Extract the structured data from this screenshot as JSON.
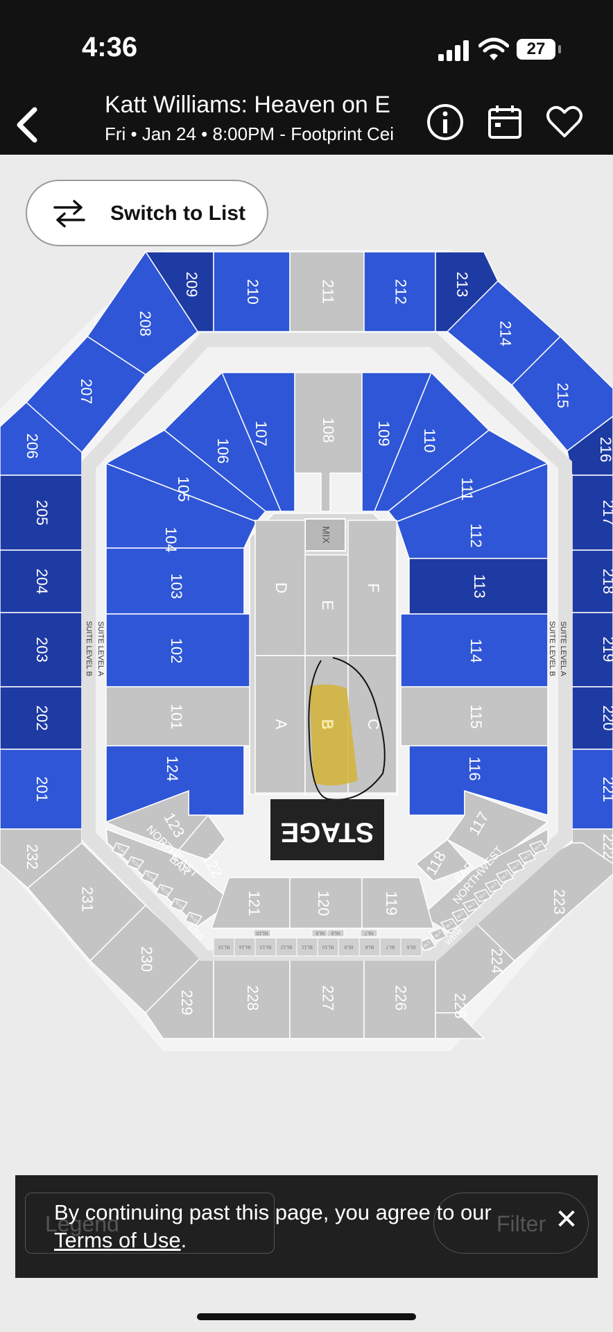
{
  "status": {
    "time": "4:36",
    "battery": "27"
  },
  "header": {
    "title": "Katt Williams: Heaven on E",
    "subtitle": "Fri • Jan 24 • 8:00PM - Footprint Cei",
    "icons": [
      "back-arrow-icon",
      "info-icon",
      "calendar-icon",
      "heart-icon"
    ]
  },
  "switch_button": {
    "label": "Switch to List",
    "icon": "swap-arrows-icon"
  },
  "seatmap": {
    "stage_label": "STAGE",
    "mix_label": "MIX",
    "northeast_bar": [
      "NORTHEAST",
      "BAR"
    ],
    "northwest_bar": [
      "NORTHWEST",
      "BAR"
    ],
    "suite_a": "SUITE LEVEL A",
    "suite_b": "SUITE LEVEL B",
    "ebw": "EBW",
    "wbw": "WBW",
    "floor": [
      "A",
      "B",
      "C",
      "D",
      "E",
      "F"
    ],
    "upper_top": [
      "209",
      "210",
      "211",
      "212",
      "213"
    ],
    "upper_left": [
      "208",
      "207",
      "206",
      "205",
      "204",
      "203",
      "202",
      "201",
      "232",
      "231",
      "230",
      "229"
    ],
    "upper_right": [
      "214",
      "215",
      "216",
      "217",
      "218",
      "219",
      "220",
      "221",
      "222",
      "223",
      "224",
      "225"
    ],
    "upper_bottom": [
      "228",
      "227",
      "226"
    ],
    "lower_top": [
      "107",
      "108",
      "109"
    ],
    "lower_left": [
      "106",
      "105",
      "104",
      "103",
      "102",
      "101",
      "124",
      "123",
      "122"
    ],
    "lower_right": [
      "110",
      "111",
      "112",
      "113",
      "114",
      "115",
      "116",
      "117",
      "118"
    ],
    "lower_bottom": [
      "121",
      "120",
      "119"
    ],
    "boxes_bottom": [
      "BL15",
      "BL14",
      "BL13",
      "BL12",
      "BL11",
      "BL10",
      "BL9",
      "BL8",
      "BL7",
      "BL6"
    ],
    "boxes_nl_top": [
      "NL10",
      "NL9",
      "NL8",
      "NL7"
    ],
    "boxes_ne": [
      "NL16",
      "NL15",
      "NL14",
      "NL13",
      "NL12",
      "NL11"
    ],
    "boxes_nw": [
      "NL6",
      "NL5",
      "NL4",
      "NL3",
      "NL2",
      "NL1",
      "BL1",
      "BL2",
      "BL3",
      "BL4",
      "BL5"
    ]
  },
  "bottom": {
    "legend": "Legend",
    "filter": "Filter"
  },
  "cookie": {
    "text_before": "By continuing past this page, you agree to our ",
    "link": "Terms of Use",
    "text_after": "."
  },
  "colors": {
    "available": "#2f56d6",
    "dark_available": "#1e3aa3",
    "unavailable": "#c4c4c4",
    "highlight": "#d4b43a",
    "stage": "#222222"
  }
}
